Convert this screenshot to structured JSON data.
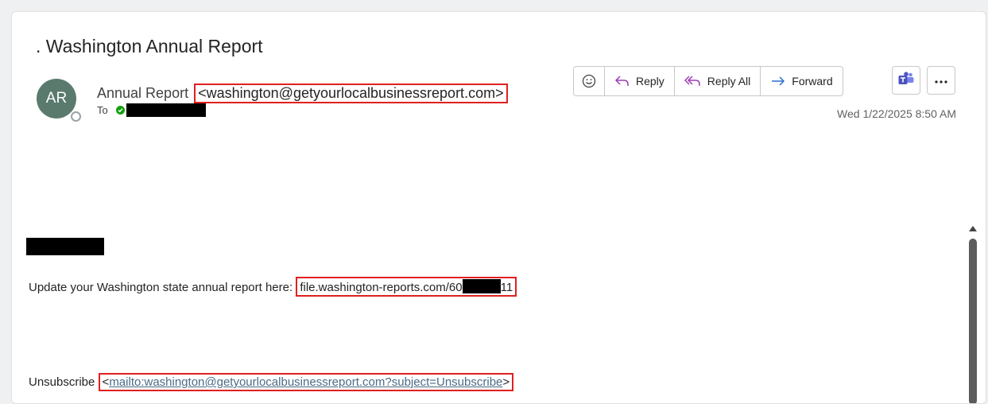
{
  "email": {
    "subject": ". Washington Annual Report",
    "sender_initials": "AR",
    "sender_name": "Annual Report",
    "sender_email": "<washington@getyourlocalbusinessreport.com>",
    "to_label": "To",
    "date": "Wed 1/22/2025 8:50 AM"
  },
  "toolbar": {
    "emoji_icon": "smiley-icon",
    "reply_label": "Reply",
    "reply_all_label": "Reply All",
    "forward_label": "Forward",
    "teams_icon": "teams-icon",
    "more_icon": "more-options-icon"
  },
  "body": {
    "line1_prefix": "Update your Washington state annual report here: ",
    "link_start": "file.washington-reports.com/60",
    "link_end": "11",
    "unsubscribe_label": "Unsubscribe ",
    "mailto_open": "<",
    "mailto_link": "mailto:washington@getyourlocalbusinessreport.com?subject=Unsubscribe",
    "mailto_close": ">"
  },
  "colors": {
    "avatar_bg": "#5a7a6e",
    "highlight_box": "#e02020",
    "icon_accent": "#2f6fcf",
    "reply_all_icon": "#9b3fb5"
  }
}
